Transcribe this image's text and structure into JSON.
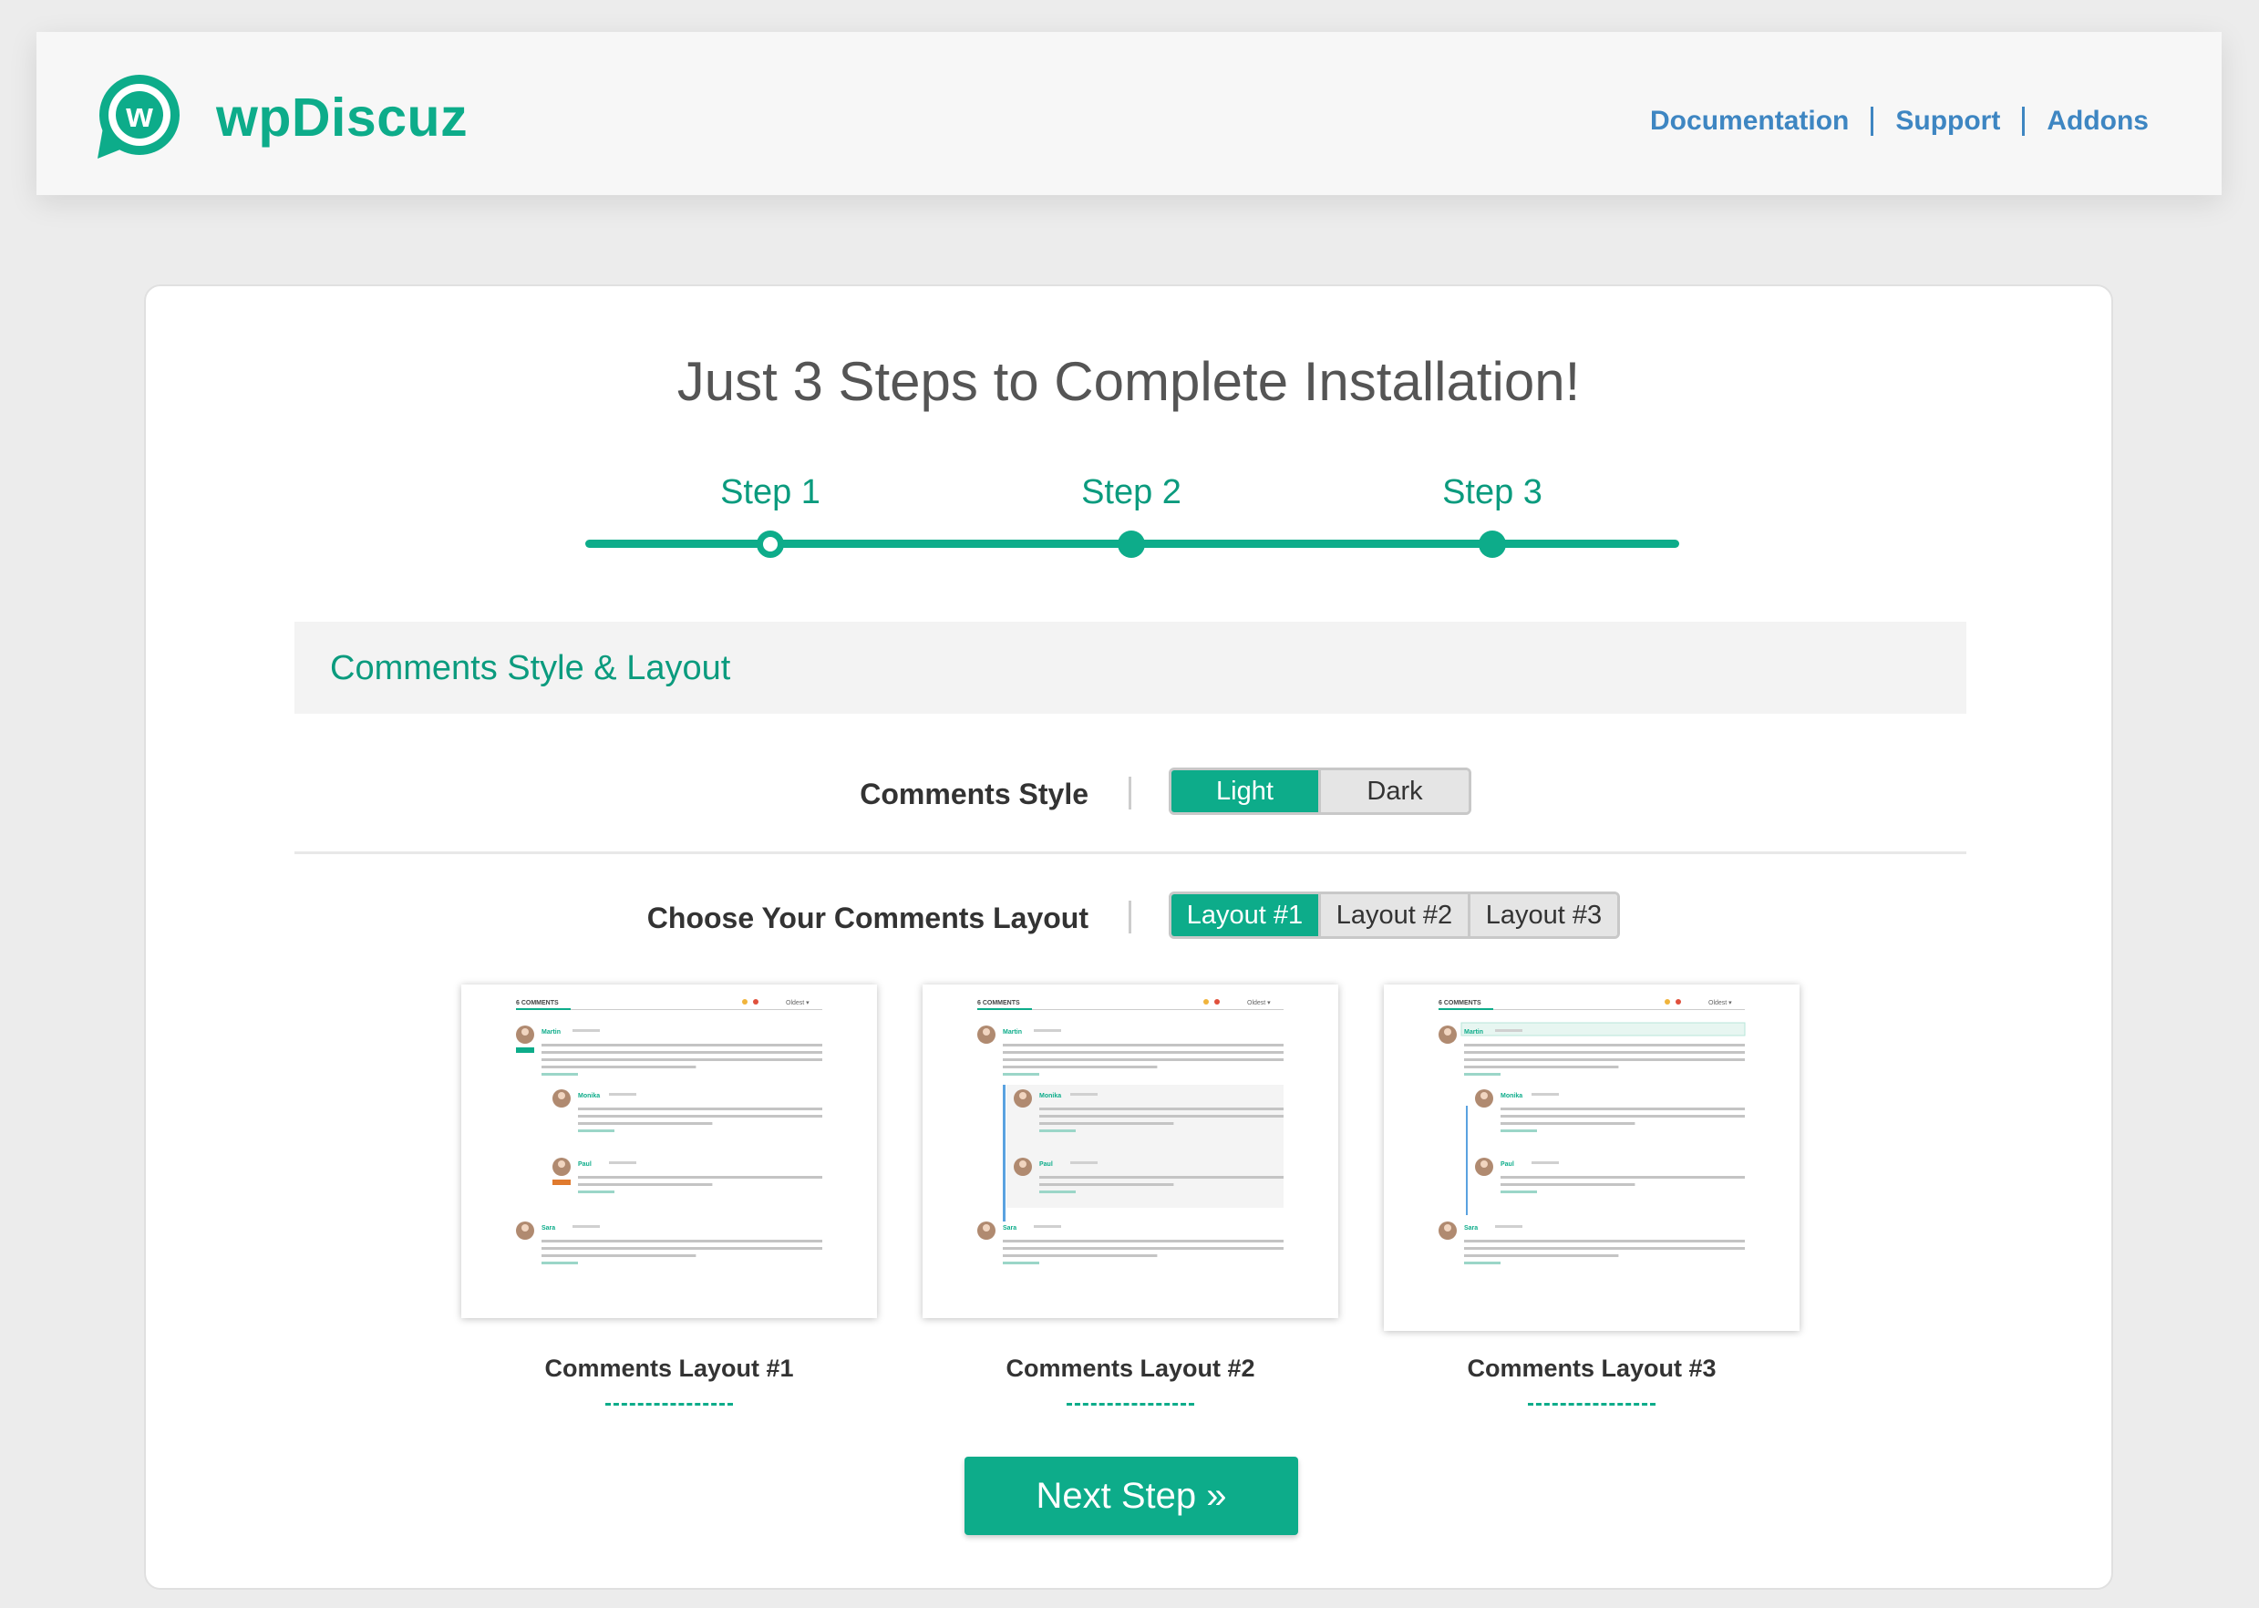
{
  "header": {
    "logo_letter": "w",
    "logo_text": "wpDiscuz",
    "nav": [
      "Documentation",
      "Support",
      "Addons"
    ]
  },
  "main": {
    "title": "Just 3 Steps to Complete Installation!",
    "steps": [
      "Step 1",
      "Step 2",
      "Step 3"
    ],
    "current_step": 1,
    "section_title": "Comments Style & Layout",
    "style_label": "Comments Style",
    "style_options": [
      "Light",
      "Dark"
    ],
    "style_selected": "Light",
    "layout_label": "Choose Your Comments Layout",
    "layout_options": [
      "Layout #1",
      "Layout #2",
      "Layout #3"
    ],
    "layout_selected": "Layout #1",
    "layouts": [
      {
        "title": "Comments Layout #1"
      },
      {
        "title": "Comments Layout #2"
      },
      {
        "title": "Comments Layout #3"
      }
    ],
    "next_button": "Next Step »"
  },
  "preview": {
    "count_label": "6 COMMENTS",
    "sort_label": "Oldest",
    "names": [
      "Martin",
      "Monika",
      "Paul",
      "Sara"
    ]
  },
  "colors": {
    "accent": "#0dac8a",
    "link": "#3e86c2"
  }
}
